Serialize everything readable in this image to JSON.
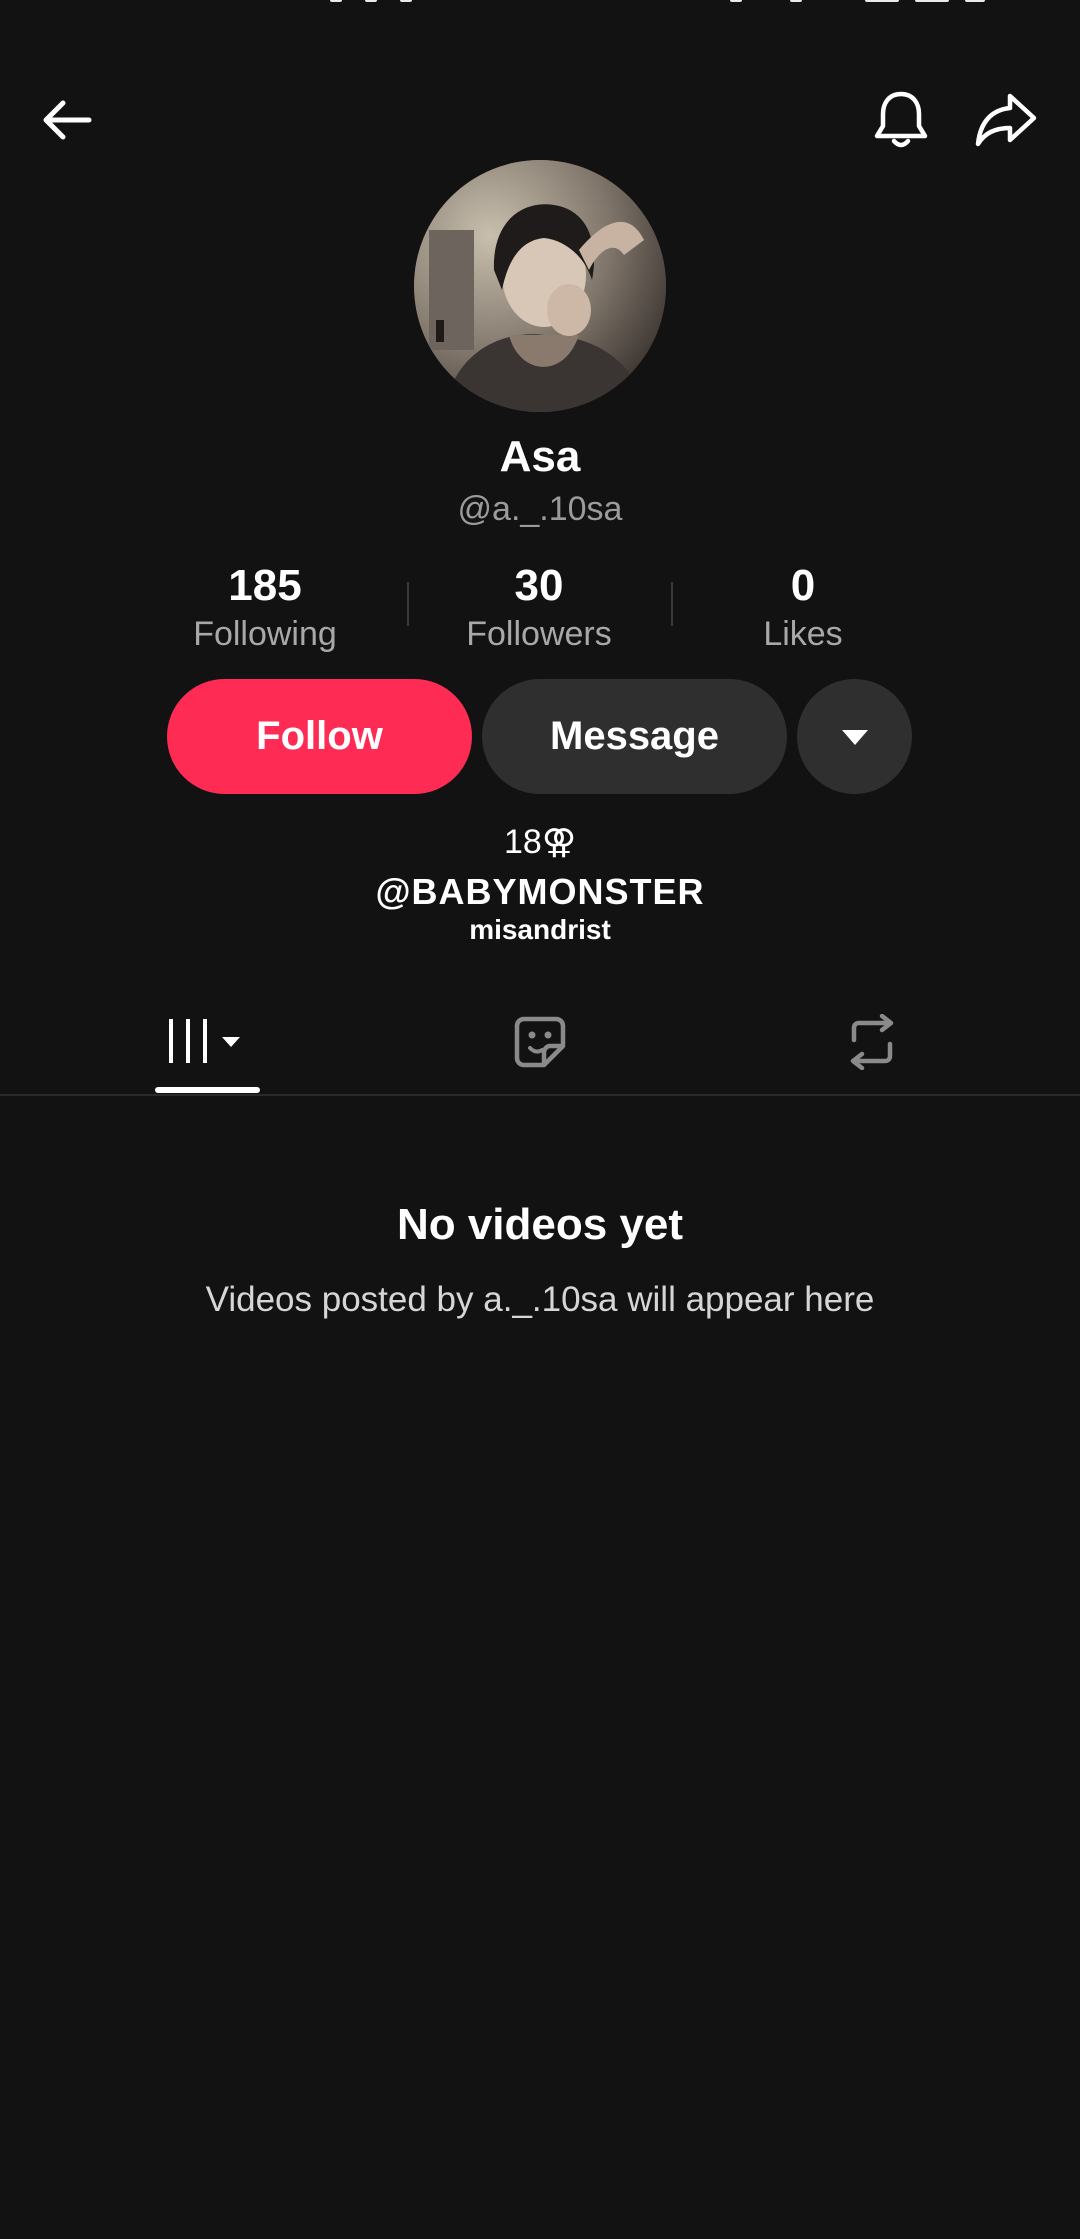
{
  "profile": {
    "display_name": "Asa",
    "handle": "@a._.10sa",
    "stats": [
      {
        "value": "185",
        "label": "Following"
      },
      {
        "value": "30",
        "label": "Followers"
      },
      {
        "value": "0",
        "label": "Likes"
      }
    ],
    "bio": {
      "line1": "18⚢",
      "line2": "@BABYMONSTER",
      "line3": "misandrist"
    }
  },
  "actions": {
    "follow_label": "Follow",
    "message_label": "Message"
  },
  "tabs": [
    {
      "icon": "videos-grid-icon",
      "active": true
    },
    {
      "icon": "liked-sticker-icon",
      "active": false
    },
    {
      "icon": "repost-icon",
      "active": false
    }
  ],
  "empty_state": {
    "title": "No videos yet",
    "subtitle": "Videos posted by a._.10sa will appear here"
  },
  "colors": {
    "background": "#121212",
    "accent": "#fe2c55",
    "secondary_button": "#2f2f2f"
  }
}
